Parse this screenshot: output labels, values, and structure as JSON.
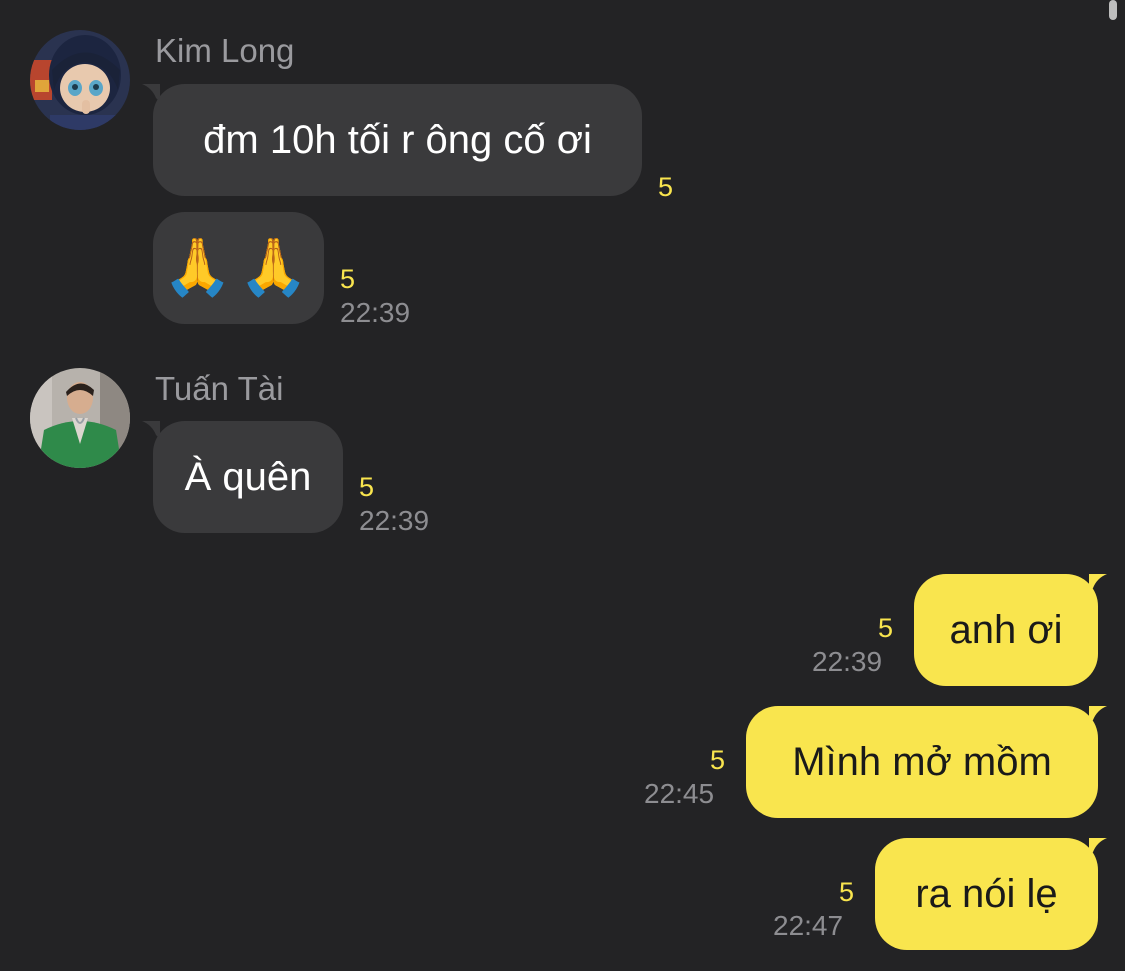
{
  "colors": {
    "background": "#232325",
    "incoming_bubble": "#3a3a3c",
    "outgoing_bubble": "#f9e54e",
    "read_count": "#f9e54e",
    "timestamp": "#8d8d91",
    "sender_name": "#9a9a9e"
  },
  "groups": [
    {
      "sender": "Kim Long",
      "avatar": "anime-character-avatar",
      "messages": [
        {
          "text": "đm 10h tối r ông cố ơi",
          "read_count": "5",
          "time": ""
        },
        {
          "text": "🙏🙏",
          "read_count": "5",
          "time": "22:39"
        }
      ]
    },
    {
      "sender": "Tuấn Tài",
      "avatar": "person-green-jacket-avatar",
      "messages": [
        {
          "text": "À quên",
          "read_count": "5",
          "time": "22:39"
        }
      ]
    }
  ],
  "outgoing": [
    {
      "text": "anh ơi",
      "read_count": "5",
      "time": "22:39"
    },
    {
      "text": "Mình mở mồm",
      "read_count": "5",
      "time": "22:45"
    },
    {
      "text": "ra nói lẹ",
      "read_count": "5",
      "time": "22:47"
    }
  ]
}
